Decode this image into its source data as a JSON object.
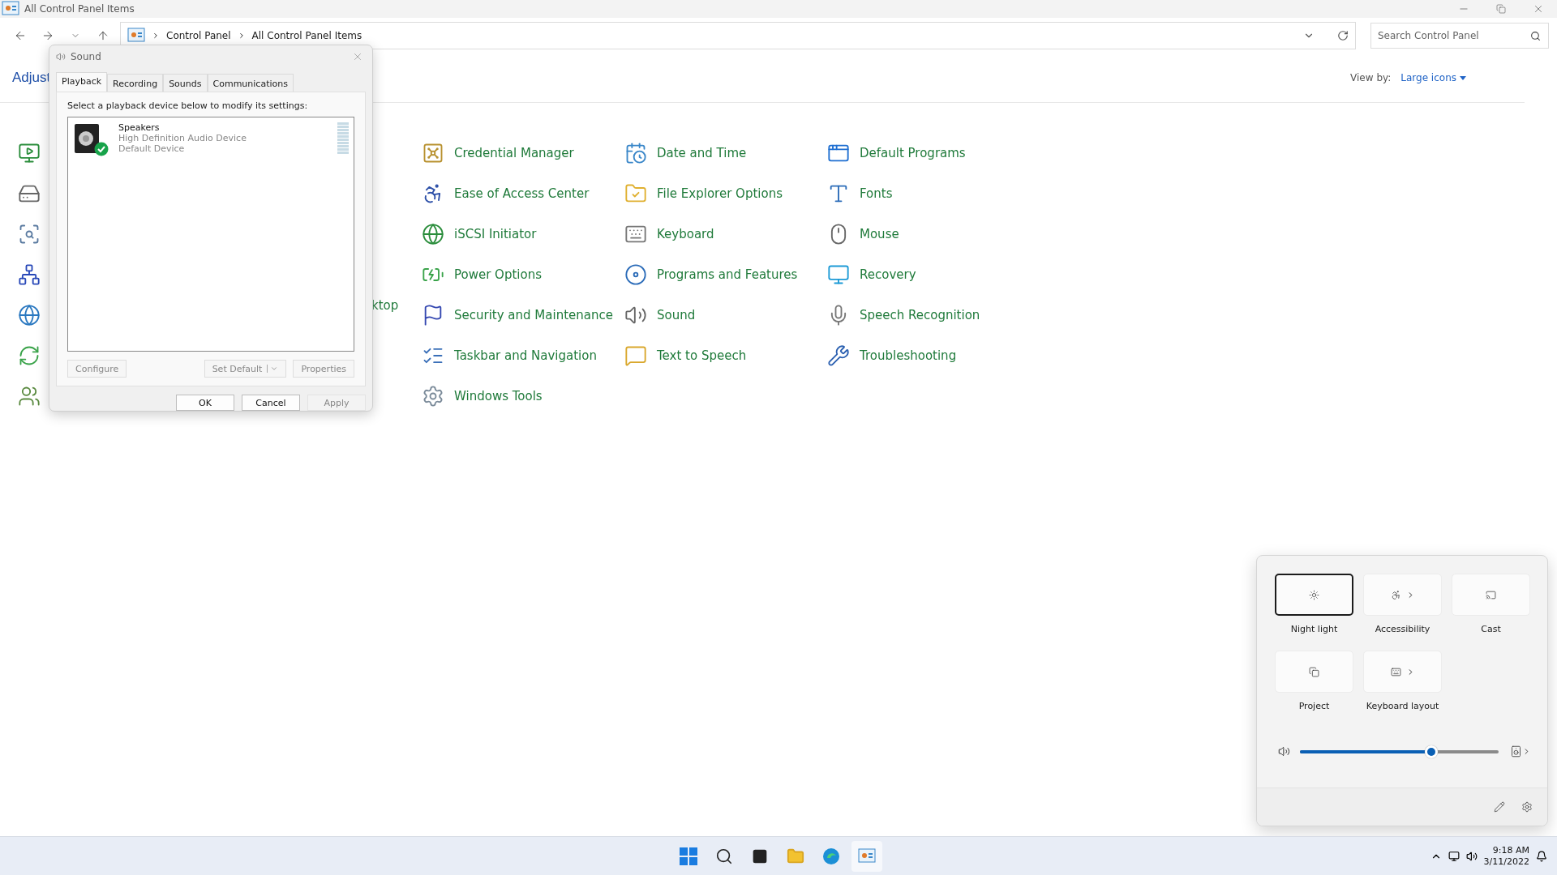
{
  "window": {
    "title": "All Control Panel Items"
  },
  "address_bar": {
    "path": [
      "Control Panel",
      "All Control Panel Items"
    ]
  },
  "search": {
    "placeholder": "Search Control Panel"
  },
  "heading": "Adjust",
  "view_by": {
    "label": "View by:",
    "value": "Large icons"
  },
  "partial_label": "ktop",
  "items": [
    "Credential Manager",
    "Date and Time",
    "Default Programs",
    "Ease of Access Center",
    "File Explorer Options",
    "Fonts",
    "iSCSI Initiator",
    "Keyboard",
    "Mouse",
    "Power Options",
    "Programs and Features",
    "Recovery",
    "Security and Maintenance",
    "Sound",
    "Speech Recognition",
    "Taskbar and Navigation",
    "Text to Speech",
    "Troubleshooting",
    "Windows Tools"
  ],
  "sound_dialog": {
    "title": "Sound",
    "tabs": [
      {
        "label": "Playback",
        "selected": true
      },
      {
        "label": "Recording",
        "selected": false
      },
      {
        "label": "Sounds",
        "selected": false
      },
      {
        "label": "Communications",
        "selected": false
      }
    ],
    "instruction": "Select a playback device below to modify its settings:",
    "devices": [
      {
        "name": "Speakers",
        "description": "High Definition Audio Device",
        "status": "Default Device",
        "default": true
      }
    ],
    "device_buttons": [
      {
        "label": "Configure",
        "disabled": true
      },
      {
        "label": "Set Default",
        "disabled": true,
        "kind": "split"
      },
      {
        "label": "Properties",
        "disabled": true
      }
    ],
    "footer_buttons": [
      {
        "label": "OK",
        "disabled": false
      },
      {
        "label": "Cancel",
        "disabled": false
      },
      {
        "label": "Apply",
        "disabled": true
      }
    ]
  },
  "quick_settings": {
    "tiles": [
      {
        "label": "Night light",
        "selected": true,
        "has_menu": false
      },
      {
        "label": "Accessibility",
        "selected": false,
        "has_menu": true
      },
      {
        "label": "Cast",
        "selected": false,
        "has_menu": false
      },
      {
        "label": "Project",
        "selected": false,
        "has_menu": false
      },
      {
        "label": "Keyboard layout",
        "selected": false,
        "has_menu": true
      }
    ],
    "volume": {
      "level": 0.66
    }
  },
  "taskbar": {
    "time": "9:18 AM",
    "date": "3/11/2022"
  }
}
